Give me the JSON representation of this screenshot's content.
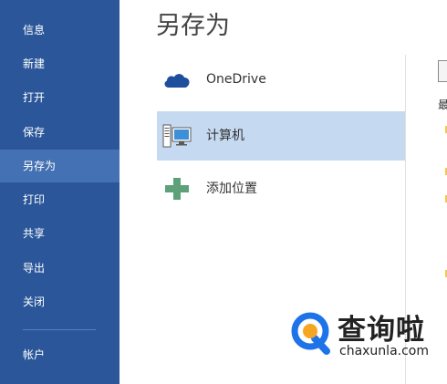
{
  "sidebar": {
    "items": [
      {
        "label": "信息"
      },
      {
        "label": "新建"
      },
      {
        "label": "打开"
      },
      {
        "label": "保存"
      },
      {
        "label": "另存为",
        "active": true
      },
      {
        "label": "打印"
      },
      {
        "label": "共享"
      },
      {
        "label": "导出"
      },
      {
        "label": "关闭"
      },
      {
        "label": "帐户"
      }
    ]
  },
  "main": {
    "title": "另存为",
    "places": [
      {
        "label": "OneDrive",
        "icon": "cloud-icon"
      },
      {
        "label": "计算机",
        "icon": "computer-icon",
        "selected": true
      },
      {
        "label": "添加位置",
        "icon": "plus-icon"
      }
    ],
    "right_pane": {
      "recent_label": "最"
    }
  },
  "watermark": {
    "text": "查询啦",
    "sub": "chaxunla.com"
  },
  "colors": {
    "sidebar_bg": "#2b579a",
    "sidebar_active": "#4471b3",
    "place_selected": "#c5d9f1",
    "accent_orange": "#f5a623",
    "accent_blue": "#1e73e8"
  }
}
